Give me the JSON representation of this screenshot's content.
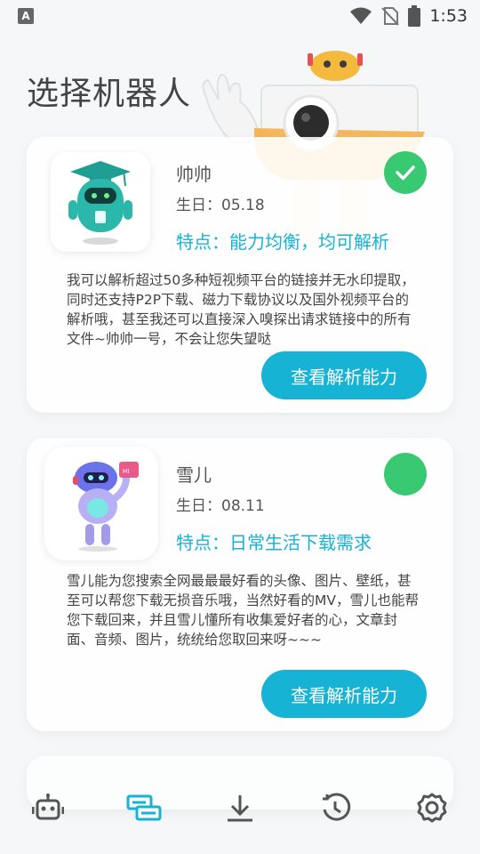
{
  "status_bar": {
    "app_indicator": "A",
    "time": "1:53",
    "icons": [
      "wifi-icon",
      "no-sim-icon",
      "battery-icon"
    ]
  },
  "header": {
    "title": "选择机器人"
  },
  "robots": [
    {
      "name": "帅帅",
      "birthday": "生日：05.18",
      "feature": "特点：能力均衡，均可解析",
      "description": "我可以解析超过50多种短视频平台的链接并无水印提取，同时还支持P2P下载、磁力下载协议以及国外视频平台的解析哦，甚至我还可以直接深入嗅探出请求链接中的所有文件~帅帅一号，不会让您失望哒",
      "button_label": "查看解析能力",
      "selected": true
    },
    {
      "name": "雪儿",
      "birthday": "生日：08.11",
      "feature": "特点：日常生活下载需求",
      "description": "雪儿能为您搜索全网最最最好看的头像、图片、壁纸，甚至可以帮您下载无损音乐哦，当然好看的MV，雪儿也能帮您下载回来，并且雪儿懂所有收集爱好者的心，文章封面、音频、图片，统统给您取回来呀~~~",
      "button_label": "查看解析能力",
      "selected": false
    }
  ],
  "bottom_nav": {
    "items": [
      "robot-icon",
      "parse-icon",
      "download-icon",
      "history-icon",
      "settings-icon"
    ],
    "active_index": 1
  },
  "colors": {
    "accent": "#16b3d4",
    "selected": "#38c972",
    "nav_icon": "#555555"
  }
}
